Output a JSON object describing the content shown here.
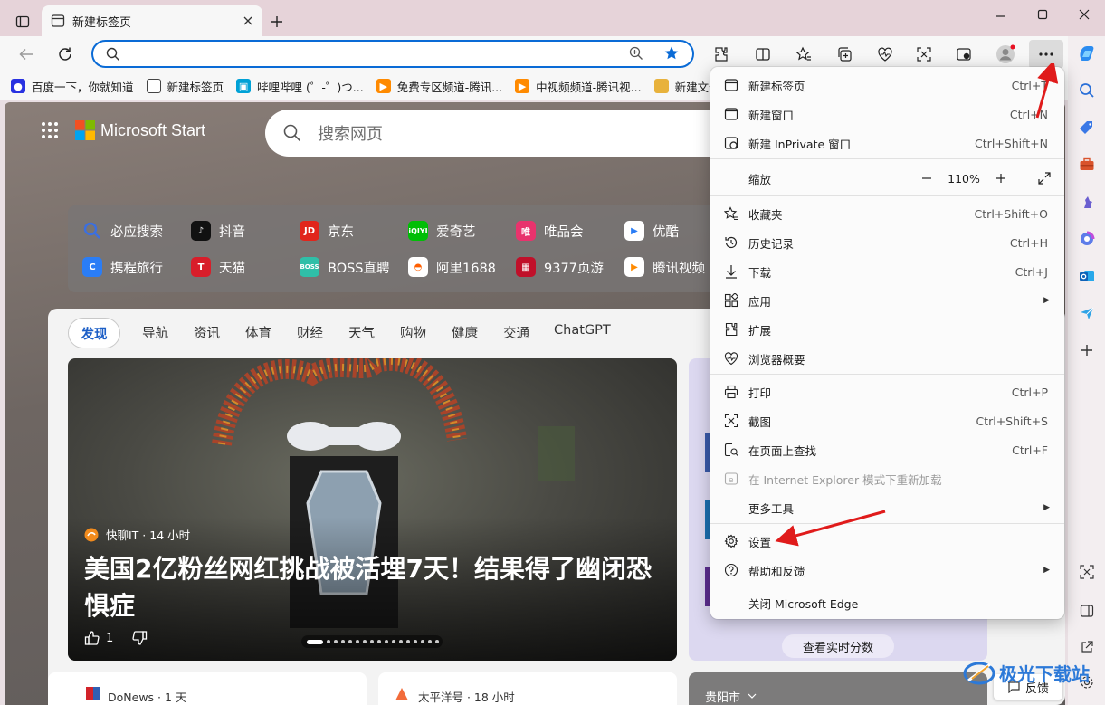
{
  "browser": {
    "tab_title": "新建标签页",
    "address_value": "",
    "favorites": [
      {
        "label": "百度一下，你就知道",
        "color": "#2932e1"
      },
      {
        "label": "新建标签页",
        "color": "#444444"
      },
      {
        "label": "哔哩哔哩 (゜-゜)つ...",
        "color": "#00a1d6"
      },
      {
        "label": "免费专区频道-腾讯...",
        "color": "#ff8a00"
      },
      {
        "label": "中视频频道-腾讯视...",
        "color": "#ff8a00"
      },
      {
        "label": "新建文件",
        "color": "#e8b23c"
      }
    ]
  },
  "page": {
    "brand": "Microsoft Start",
    "search_placeholder": "搜索网页",
    "quick_links": [
      {
        "label": "必应搜索",
        "icon": "search-icon",
        "color": "#3b6fe0"
      },
      {
        "label": "抖音",
        "icon": "douyin-icon",
        "color": "#111111"
      },
      {
        "label": "京东",
        "icon": "jd-icon",
        "color": "#e1251b"
      },
      {
        "label": "爱奇艺",
        "icon": "iqiyi-icon",
        "color": "#00be06"
      },
      {
        "label": "唯品会",
        "icon": "vip-icon",
        "color": "#e8336d"
      },
      {
        "label": "优酷",
        "icon": "youku-icon",
        "color": "#ffffff"
      },
      {
        "label": "携程旅行",
        "icon": "ctrip-icon",
        "color": "#2a7df6"
      },
      {
        "label": "天猫",
        "icon": "tmall-icon",
        "color": "#d81e2a"
      },
      {
        "label": "BOSS直聘",
        "icon": "boss-icon",
        "color": "#2fbfa8"
      },
      {
        "label": "阿里1688",
        "icon": "1688-icon",
        "color": "#ff5f00"
      },
      {
        "label": "9377页游",
        "icon": "9377-icon",
        "color": "#c0102a"
      },
      {
        "label": "腾讯视频",
        "icon": "tencent-video-icon",
        "color": "#ff8a00"
      }
    ],
    "feed_tabs": [
      "发现",
      "导航",
      "资讯",
      "体育",
      "财经",
      "天气",
      "购物",
      "健康",
      "交通",
      "ChatGPT"
    ],
    "hero": {
      "source": "快聊IT · 14 小时",
      "headline": "美国2亿粉丝网红挑战被活埋7天！结果得了幽闭恐惧症",
      "likes": "1"
    },
    "right_panel_button": "查看实时分数",
    "bottom_cards": [
      {
        "source": "DoNews · 1 天"
      },
      {
        "source": "太平洋号 · 18 小时"
      },
      {
        "source": "贵阳市"
      }
    ],
    "feedback_label": "反馈"
  },
  "menu": {
    "items": [
      {
        "label": "新建标签页",
        "shortcut": "Ctrl+T",
        "icon": "new-tab-icon"
      },
      {
        "label": "新建窗口",
        "shortcut": "Ctrl+N",
        "icon": "new-window-icon"
      },
      {
        "label": "新建 InPrivate 窗口",
        "shortcut": "Ctrl+Shift+N",
        "icon": "inprivate-icon"
      },
      {
        "label": "缩放",
        "zoom_value": "110%",
        "icon": "zoom"
      },
      {
        "label": "收藏夹",
        "shortcut": "Ctrl+Shift+O",
        "icon": "favorites-icon"
      },
      {
        "label": "历史记录",
        "shortcut": "Ctrl+H",
        "icon": "history-icon"
      },
      {
        "label": "下载",
        "shortcut": "Ctrl+J",
        "icon": "download-icon"
      },
      {
        "label": "应用",
        "icon": "apps-icon"
      },
      {
        "label": "扩展",
        "icon": "extensions-icon"
      },
      {
        "label": "浏览器概要",
        "icon": "browser-essentials-icon"
      },
      {
        "label": "打印",
        "shortcut": "Ctrl+P",
        "icon": "print-icon"
      },
      {
        "label": "截图",
        "shortcut": "Ctrl+Shift+S",
        "icon": "screenshot-icon"
      },
      {
        "label": "在页面上查找",
        "shortcut": "Ctrl+F",
        "icon": "find-icon"
      },
      {
        "label": "在 Internet Explorer 模式下重新加载",
        "icon": "ie-icon"
      },
      {
        "label": "更多工具",
        "icon": "more-tools"
      },
      {
        "label": "设置",
        "icon": "settings-icon"
      },
      {
        "label": "帮助和反馈",
        "icon": "help-icon"
      },
      {
        "label": "关闭 Microsoft Edge",
        "icon": "none"
      }
    ]
  },
  "watermark": "极光下载站"
}
